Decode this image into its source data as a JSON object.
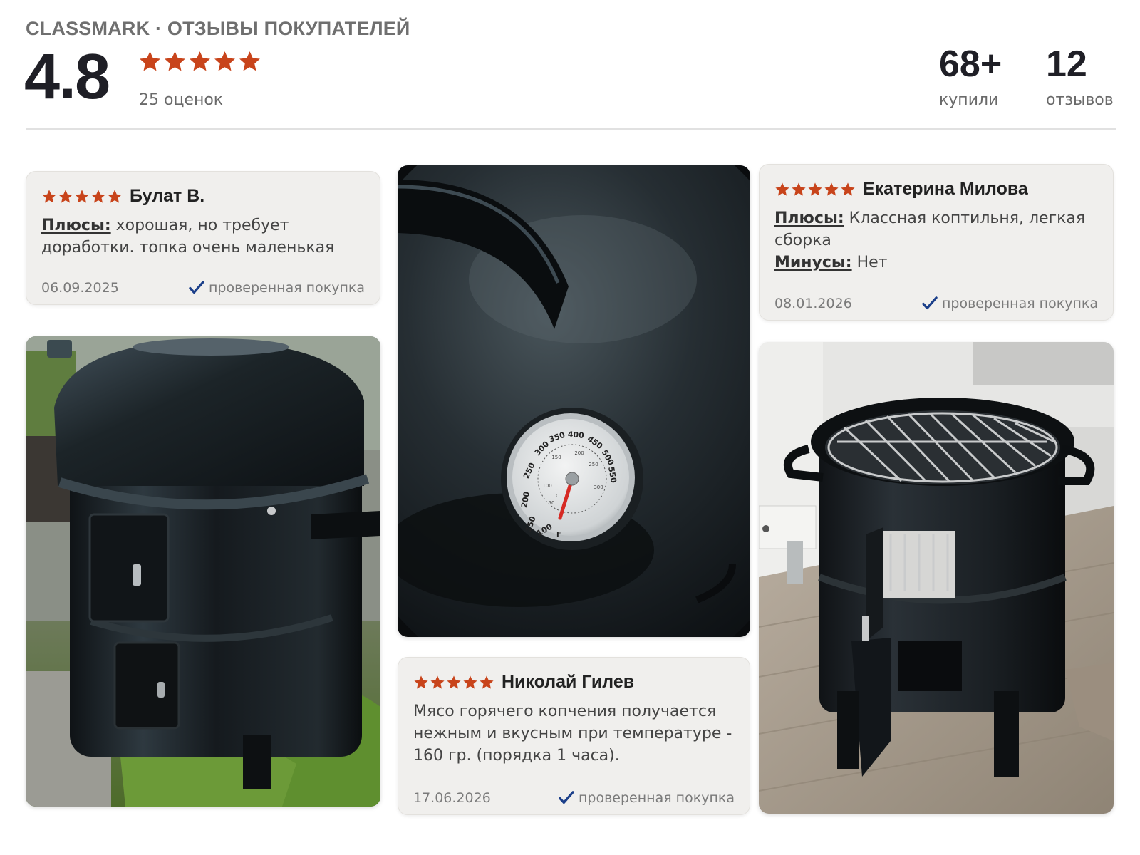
{
  "header": {
    "brand": "CLASSMARK · ОТЗЫВЫ ПОКУПАТЕЛЕЙ",
    "rating": "4.8",
    "ratings_count": "25 оценок",
    "stats": [
      {
        "value": "68+",
        "label": "купили"
      },
      {
        "value": "12",
        "label": "отзывов"
      }
    ]
  },
  "colors": {
    "star": "#c8441b",
    "check": "#1b3f8a",
    "card_bg": "#f0efed"
  },
  "reviews": [
    {
      "stars": 5,
      "author": "Булат В.",
      "pros_label": "Плюсы:",
      "pros": "хорошая, но требует доработки. топка очень маленькая",
      "date": "06.09.2025",
      "verified": "проверенная покупка"
    },
    {
      "stars": 5,
      "author": "Екатерина Милова",
      "pros_label": "Плюсы:",
      "pros": "Классная коптильня, легкая сборка",
      "cons_label": "Минусы:",
      "cons": "Нет",
      "date": "08.01.2026",
      "verified": "проверенная покупка"
    },
    {
      "stars": 5,
      "author": "Николай Гилев",
      "text": "Мясо горячего копчения получается нежным и вкусным при температуре - 160 гр. (порядка 1 часа).",
      "date": "17.06.2026",
      "verified": "проверенная покупка"
    }
  ],
  "photos": [
    {
      "name": "smoker-outdoor-photo"
    },
    {
      "name": "thermometer-lid-photo"
    },
    {
      "name": "smoker-indoor-photo"
    }
  ],
  "thermometer": {
    "scale_f": [
      "100",
      "150",
      "200",
      "250",
      "300",
      "350",
      "400",
      "450",
      "500",
      "550"
    ],
    "scale_c": [
      "50",
      "100",
      "150",
      "200",
      "250",
      "300"
    ],
    "unit_f": "F",
    "unit_c": "C"
  }
}
